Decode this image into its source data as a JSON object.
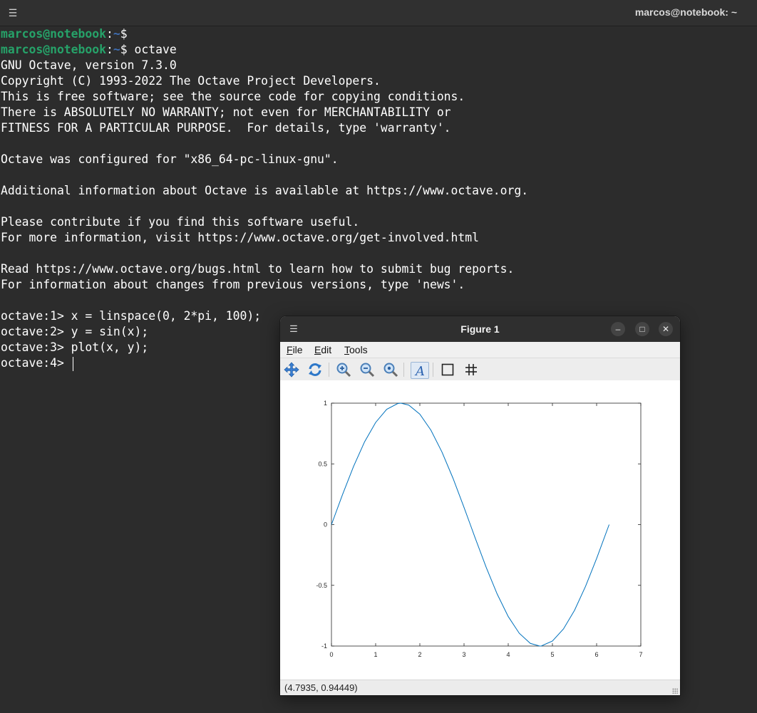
{
  "terminal": {
    "title": "marcos@notebook: ~",
    "prompt_user": "marcos@notebook",
    "prompt_sep": ":",
    "prompt_path": "~",
    "prompt_dollar": "$ ",
    "command_1": "",
    "command_2": "octave",
    "output": [
      "GNU Octave, version 7.3.0",
      "Copyright (C) 1993-2022 The Octave Project Developers.",
      "This is free software; see the source code for copying conditions.",
      "There is ABSOLUTELY NO WARRANTY; not even for MERCHANTABILITY or",
      "FITNESS FOR A PARTICULAR PURPOSE.  For details, type 'warranty'.",
      "",
      "Octave was configured for \"x86_64-pc-linux-gnu\".",
      "",
      "Additional information about Octave is available at https://www.octave.org.",
      "",
      "Please contribute if you find this software useful.",
      "For more information, visit https://www.octave.org/get-involved.html",
      "",
      "Read https://www.octave.org/bugs.html to learn how to submit bug reports.",
      "For information about changes from previous versions, type 'news'.",
      "",
      "octave:1> x = linspace(0, 2*pi, 100);",
      "octave:2> y = sin(x);",
      "octave:3> plot(x, y);"
    ],
    "current_prompt": "octave:4> "
  },
  "figure": {
    "title": "Figure 1",
    "menu": [
      "File",
      "Edit",
      "Tools"
    ],
    "toolbar": [
      "pan-icon",
      "rotate-icon",
      "zoom-in-icon",
      "zoom-out-icon",
      "zoom-auto-icon",
      "text-icon",
      "axes-box-icon",
      "grid-icon"
    ],
    "status": "(4.7935, 0.94449)",
    "window_buttons": [
      "minimize",
      "maximize",
      "close"
    ]
  },
  "chart_data": {
    "type": "line",
    "series": [
      {
        "x": [
          0,
          0.25,
          0.5,
          0.75,
          1,
          1.25,
          1.5,
          1.571,
          1.75,
          2,
          2.25,
          2.5,
          2.75,
          3,
          3.142,
          3.25,
          3.5,
          3.75,
          4,
          4.25,
          4.5,
          4.712,
          4.75,
          5,
          5.25,
          5.5,
          5.75,
          6,
          6.283
        ],
        "y": [
          0,
          0.247,
          0.479,
          0.682,
          0.841,
          0.949,
          0.997,
          1,
          0.984,
          0.909,
          0.778,
          0.598,
          0.382,
          0.141,
          0,
          -0.108,
          -0.351,
          -0.572,
          -0.757,
          -0.895,
          -0.978,
          -1,
          -0.999,
          -0.959,
          -0.859,
          -0.706,
          -0.508,
          -0.279,
          0
        ],
        "color": "#0072bd"
      }
    ],
    "xlim": [
      0,
      7
    ],
    "ylim": [
      -1,
      1
    ],
    "xticks": [
      "0",
      "1",
      "2",
      "3",
      "4",
      "5",
      "6",
      "7"
    ],
    "yticks": [
      "1",
      "0.5",
      "0",
      "-0.5",
      "-1"
    ],
    "grid": false,
    "box": true
  }
}
